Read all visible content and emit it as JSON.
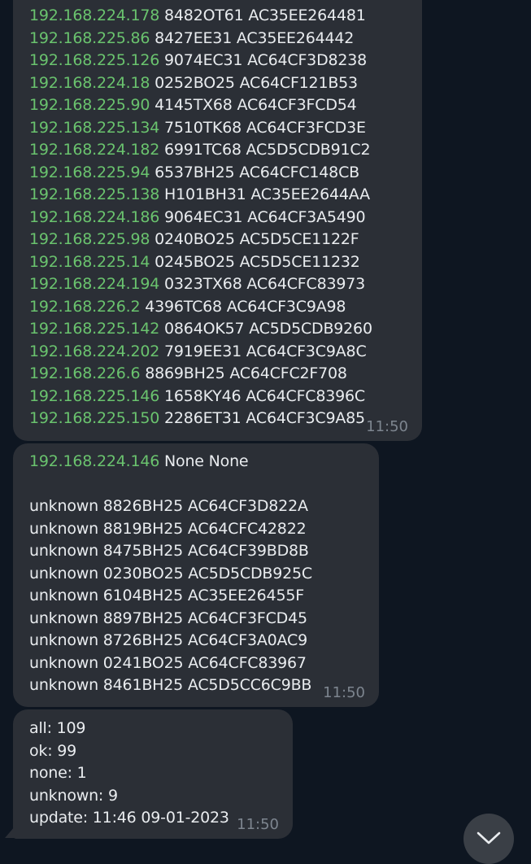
{
  "messages": [
    {
      "time": "11:50",
      "lines": [
        {
          "ip": "192.168.224.178",
          "rest": "8482OT61 AC35EE264481"
        },
        {
          "ip": "192.168.225.86",
          "rest": "8427EE31 AC35EE264442"
        },
        {
          "ip": "192.168.225.126",
          "rest": "9074EC31 AC64CF3D8238"
        },
        {
          "ip": "192.168.224.18",
          "rest": "0252BO25 AC64CF121B53"
        },
        {
          "ip": "192.168.225.90",
          "rest": "4145TX68 AC64CF3FCD54"
        },
        {
          "ip": "192.168.225.134",
          "rest": "7510TK68 AC64CF3FCD3E"
        },
        {
          "ip": "192.168.224.182",
          "rest": "6991TC68 AC5D5CDB91C2"
        },
        {
          "ip": "192.168.225.94",
          "rest": "6537BH25 AC64CFC148CB"
        },
        {
          "ip": "192.168.225.138",
          "rest": "H101BH31 AC35EE2644AA"
        },
        {
          "ip": "192.168.224.186",
          "rest": "9064EC31 AC64CF3A5490"
        },
        {
          "ip": "192.168.225.98",
          "rest": "0240BO25 AC5D5CE1122F"
        },
        {
          "ip": "192.168.225.14",
          "rest": "0245BO25 AC5D5CE11232"
        },
        {
          "ip": "192.168.224.194",
          "rest": "0323TX68 AC64CFC83973"
        },
        {
          "ip": "192.168.226.2",
          "rest": "4396TC68 AC64CF3C9A98"
        },
        {
          "ip": "192.168.225.142",
          "rest": "0864OK57 AC5D5CDB9260"
        },
        {
          "ip": "192.168.224.202",
          "rest": "7919EE31 AC64CF3C9A8C"
        },
        {
          "ip": "192.168.226.6",
          "rest": "8869BH25 AC64CFC2F708"
        },
        {
          "ip": "192.168.225.146",
          "rest": "1658KY46 AC64CFC8396C"
        },
        {
          "ip": "192.168.225.150",
          "rest": "2286ET31 AC64CF3C9A85"
        }
      ]
    },
    {
      "time": "11:50",
      "first_ip": "192.168.224.146",
      "first_rest": "None None",
      "lines": [
        "unknown 8826BH25 AC64CF3D822A",
        "unknown 8819BH25 AC64CFC42822",
        "unknown 8475BH25 AC64CF39BD8B",
        "unknown 0230BO25 AC5D5CDB925C",
        "unknown 6104BH25 AC35EE26455F",
        "unknown 8897BH25 AC64CF3FCD45",
        "unknown 8726BH25 AC64CF3A0AC9",
        "unknown 0241BO25 AC64CFC83967",
        "unknown 8461BH25 AC5D5CC6C9BB"
      ]
    },
    {
      "time": "11:50",
      "lines": [
        "all: 109",
        "ok: 99",
        "none: 1",
        "unknown: 9",
        "update: 11:46 09-01-2023"
      ]
    }
  ],
  "colors": {
    "background": "#0e1621",
    "bubble": "#2b2f36",
    "ip": "#6ac36e",
    "text": "#e9ecef",
    "time": "#7d858f"
  },
  "scroll_button_icon": "chevron-down-icon"
}
